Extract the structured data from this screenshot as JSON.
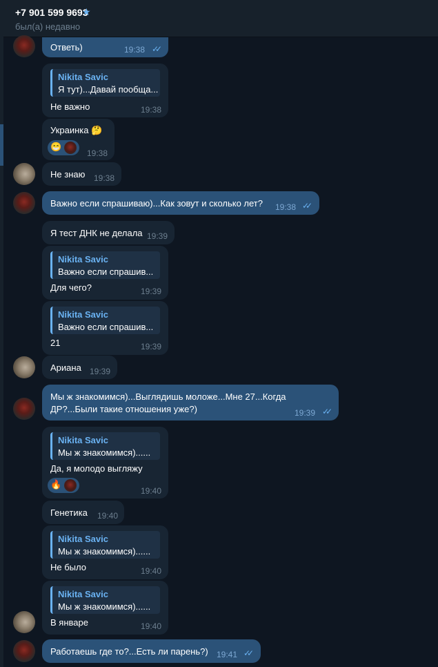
{
  "header": {
    "phone": "+7 901 599 9693",
    "star_icon": "★",
    "status": "был(а) недавно"
  },
  "messages": [
    {
      "text": "Ответь)",
      "time": "19:38",
      "ticks": "✓✓"
    },
    {
      "quote_name": "Nikita Savic",
      "quote_text": "Я тут)...Давай пообща...",
      "text": "Не важно",
      "time": "19:38"
    },
    {
      "text": "Украинка 🤔",
      "reaction": "😁",
      "time": "19:38"
    },
    {
      "text": "Не знаю",
      "time": "19:38"
    },
    {
      "text": "Важно если спрашиваю)...Как зовут и сколько лет?",
      "time": "19:38",
      "ticks": "✓✓"
    },
    {
      "text": "Я тест ДНК не делала",
      "time": "19:39"
    },
    {
      "quote_name": "Nikita Savic",
      "quote_text": "Важно если спрашив...",
      "text": "Для чего?",
      "time": "19:39"
    },
    {
      "quote_name": "Nikita Savic",
      "quote_text": "Важно если спрашив...",
      "text": "21",
      "time": "19:39"
    },
    {
      "text": "Ариана",
      "time": "19:39"
    },
    {
      "line1": "Мы ж знакомимся)...Выглядишь моложе...Мне 27...Когда",
      "line2": "ДР?...Были такие отношения уже?)",
      "time": "19:39",
      "ticks": "✓✓"
    },
    {
      "quote_name": "Nikita Savic",
      "quote_text": "Мы ж знакомимся)......",
      "text": "Да, я молодо выгляжу",
      "reaction": "🔥",
      "time": "19:40"
    },
    {
      "text": "Генетика",
      "time": "19:40"
    },
    {
      "quote_name": "Nikita Savic",
      "quote_text": "Мы ж знакомимся)......",
      "text": "Не было",
      "time": "19:40"
    },
    {
      "quote_name": "Nikita Savic",
      "quote_text": "Мы ж знакомимся)......",
      "text": "В январе",
      "time": "19:40"
    },
    {
      "text": "Работаешь где то?...Есть ли парень?)",
      "time": "19:41",
      "ticks": "✓✓"
    }
  ]
}
